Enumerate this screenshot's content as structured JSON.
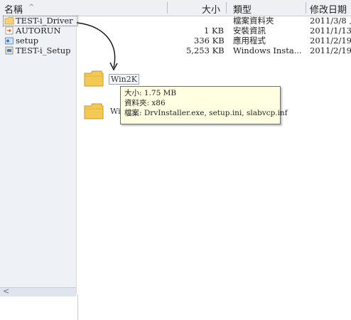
{
  "header": {
    "name": "名稱",
    "size": "大小",
    "type": "類型",
    "date": "修改日期"
  },
  "files": [
    {
      "name": "TEST-i_Driver",
      "size": "",
      "type": "檔案資料夾",
      "date": "2011/3/8 上",
      "icon": "folder-icon"
    },
    {
      "name": "AUTORUN",
      "size": "1 KB",
      "type": "安裝資訊",
      "date": "2011/1/13",
      "icon": "autorun-icon"
    },
    {
      "name": "setup",
      "size": "336 KB",
      "type": "應用程式",
      "date": "2011/2/19",
      "icon": "setup-exe-icon"
    },
    {
      "name": "TEST-i_Setup",
      "size": "5,253 KB",
      "type": "Windows Insta...",
      "date": "2011/2/19",
      "icon": "msi-installer-icon"
    }
  ],
  "folders": [
    {
      "name": "Win2K"
    },
    {
      "name": "Wi"
    }
  ],
  "tooltip": {
    "line1": "大小: 1.75 MB",
    "line2": "資料夾: x86",
    "line3": "檔案: DrvInstaller.exe, setup.ini, slabvcp.inf"
  }
}
